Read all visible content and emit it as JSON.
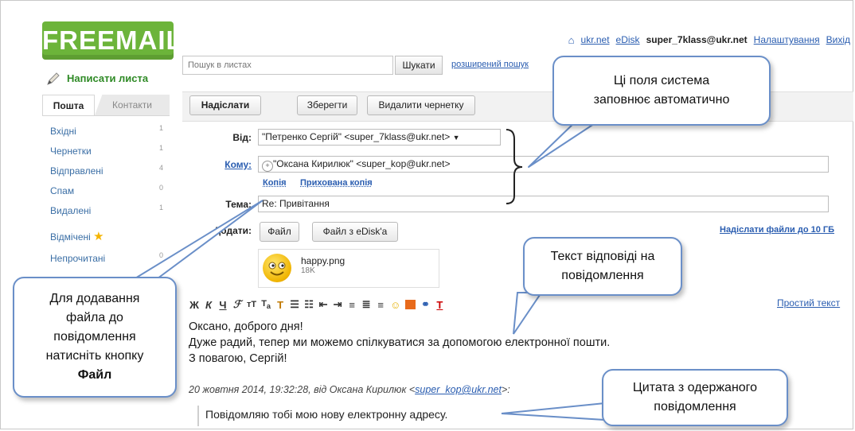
{
  "app": {
    "logo_text": "FREEMAIL",
    "compose_label": "Написати листа"
  },
  "top_links": {
    "home": "ukr.net",
    "edisk": "eDisk",
    "user": "super_7klass@ukr.net",
    "settings": "Налаштування",
    "logout": "Вихід"
  },
  "search": {
    "placeholder": "Пошук в листах",
    "button": "Шукати",
    "advanced": "розширений пошук"
  },
  "tabs": {
    "mail": "Пошта",
    "contacts": "Контакти"
  },
  "folders": [
    {
      "label": "Вхідні",
      "count": "1"
    },
    {
      "label": "Чернетки",
      "count": "1"
    },
    {
      "label": "Відправлені",
      "count": "4"
    },
    {
      "label": "Спам",
      "count": "0"
    },
    {
      "label": "Видалені",
      "count": "1"
    },
    {
      "label": "Відмічені",
      "count": ""
    },
    {
      "label": "Непрочитані",
      "count": "0"
    }
  ],
  "toolbar": {
    "send": "Надіслати",
    "save": "Зберегти",
    "delete_draft": "Видалити чернетку"
  },
  "form": {
    "from_label": "Від:",
    "from_value": "\"Петренко Сергій\" <super_7klass@ukr.net>",
    "to_label": "Кому:",
    "to_value": "\"Оксана Кирилюк\" <super_kop@ukr.net>",
    "cc_link": "Копія",
    "bcc_link": "Прихована копія",
    "subject_label": "Тема:",
    "subject_value": "Re: Привітання",
    "attach_label": "Додати:",
    "file_button": "Файл",
    "edisk_button": "Файл з eDisk'a",
    "send_files_link": "Надіслати файли до 10 ГБ"
  },
  "attachment": {
    "name": "happy.png",
    "size": "18K"
  },
  "editor": {
    "plain_text_link": "Простий текст",
    "body_lines": [
      "Оксано, доброго дня!",
      "Дуже радий, тепер ми можемо спілкуватися за допомогою електронної пошти.",
      "З повагою, Сергій!"
    ],
    "quote_header_prefix": "20 жовтня 2014, 19:32:28, від Оксана Кирилюк <",
    "quote_email": "super_kop@ukr.net",
    "quote_header_suffix": ">:",
    "quote_text": "Повідомляю тобі мою нову електронну адресу."
  },
  "callouts": {
    "auto_fields": [
      "Ці поля система",
      "заповнює автоматично"
    ],
    "reply_text": [
      "Текст відповіді на",
      "повідомлення"
    ],
    "attach_file": [
      "Для додавання",
      "файла до",
      "повідомлення",
      "натисніть кнопку"
    ],
    "attach_file_bold": "Файл",
    "quote": [
      "Цитата з одержаного",
      "повідомлення"
    ]
  },
  "colors": {
    "logo_green": "#6cb43a",
    "link_blue": "#2a5db0",
    "callout_border": "#6a8fc8"
  }
}
